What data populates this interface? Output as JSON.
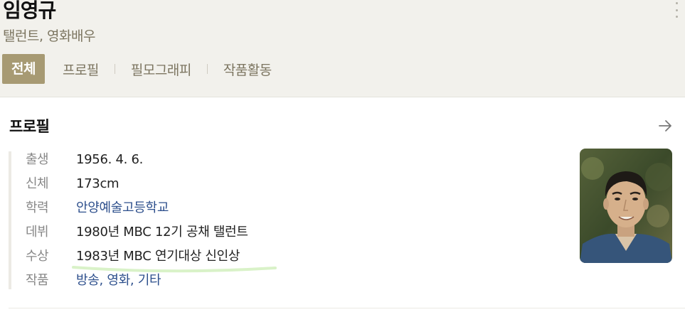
{
  "header": {
    "name": "임영규",
    "subtitle": "탤런트, 영화배우"
  },
  "tabs": [
    {
      "label": "전체",
      "active": true
    },
    {
      "label": "프로필",
      "active": false
    },
    {
      "label": "필모그래피",
      "active": false
    },
    {
      "label": "작품활동",
      "active": false
    }
  ],
  "profile": {
    "title": "프로필",
    "rows": [
      {
        "key": "출생",
        "value": "1956. 4. 6."
      },
      {
        "key": "신체",
        "value": "173cm"
      },
      {
        "key": "학력",
        "value": "안양예술고등학교"
      },
      {
        "key": "데뷔",
        "value": "1980년 MBC 12기 공채 탤런트"
      },
      {
        "key": "수상",
        "value": "1983년 MBC 연기대상 신인상"
      },
      {
        "key": "작품",
        "value": "방송, 영화, 기타"
      }
    ]
  },
  "icons": {
    "more": "more-vertical-icon",
    "arrow": "arrow-right-icon"
  },
  "colors": {
    "header_bg": "#f2f1ec",
    "accent": "#a79a73",
    "link": "#2d4f8c",
    "highlight": "#d9f2c8"
  }
}
